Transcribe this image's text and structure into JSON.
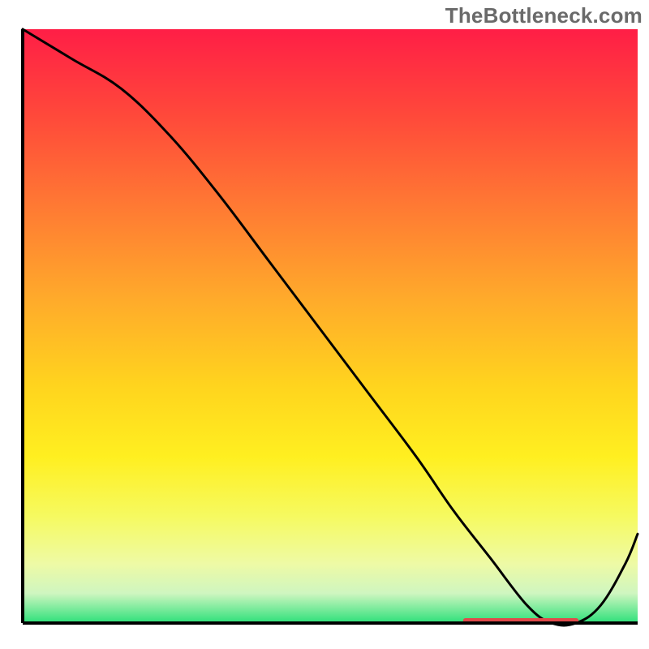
{
  "watermark": "TheBottleneck.com",
  "chart_data": {
    "type": "line",
    "title": "",
    "xlabel": "",
    "ylabel": "",
    "xlim": [
      0,
      100
    ],
    "ylim": [
      0,
      100
    ],
    "grid": false,
    "legend": false,
    "background_gradient": {
      "stops": [
        {
          "offset": 0.0,
          "color": "#FF1E46"
        },
        {
          "offset": 0.15,
          "color": "#FF4A3A"
        },
        {
          "offset": 0.3,
          "color": "#FF7A33"
        },
        {
          "offset": 0.45,
          "color": "#FFA92B"
        },
        {
          "offset": 0.6,
          "color": "#FFD41E"
        },
        {
          "offset": 0.72,
          "color": "#FFEF20"
        },
        {
          "offset": 0.82,
          "color": "#F6FA60"
        },
        {
          "offset": 0.9,
          "color": "#EEFAA5"
        },
        {
          "offset": 0.95,
          "color": "#CFF6C0"
        },
        {
          "offset": 1.0,
          "color": "#2DE07A"
        }
      ]
    },
    "series": [
      {
        "name": "curve",
        "stroke": "#000000",
        "stroke_width": 3,
        "x": [
          0,
          8,
          16,
          24,
          32,
          40,
          48,
          56,
          64,
          70,
          76,
          82,
          86,
          90,
          94,
          98,
          100
        ],
        "values": [
          100,
          95,
          90,
          82,
          72,
          61,
          50,
          39,
          28,
          19,
          11,
          3,
          0,
          0,
          3,
          10,
          15
        ]
      }
    ],
    "markers": [
      {
        "name": "baseline-segment",
        "type": "segment",
        "color": "#E04A4A",
        "stroke_width": 6,
        "x0": 72,
        "y0": 0,
        "x1": 90,
        "y1": 0
      }
    ]
  }
}
